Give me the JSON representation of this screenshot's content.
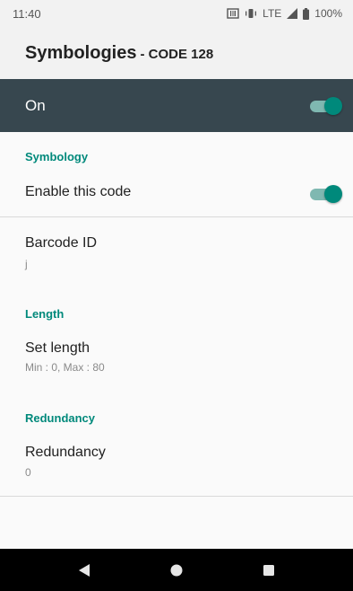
{
  "status_bar": {
    "time": "11:40",
    "network": "LTE",
    "battery": "100%"
  },
  "app_bar": {
    "title": "Symbologies",
    "subtitle": "- CODE 128"
  },
  "master_switch": {
    "label": "On",
    "checked": true
  },
  "sections": {
    "symbology": {
      "header": "Symbology",
      "enable_label": "Enable this code",
      "enable_checked": true
    },
    "barcode_id": {
      "title": "Barcode ID",
      "value": "j"
    },
    "length": {
      "header": "Length",
      "title": "Set length",
      "summary": "Min : 0, Max : 80"
    },
    "redundancy": {
      "header": "Redundancy",
      "title": "Redundancy",
      "value": "0"
    }
  },
  "nav": {
    "back": "back-icon",
    "home": "home-icon",
    "recents": "recents-icon"
  },
  "colors": {
    "accent": "#00897b",
    "master_bar": "#37474f"
  }
}
